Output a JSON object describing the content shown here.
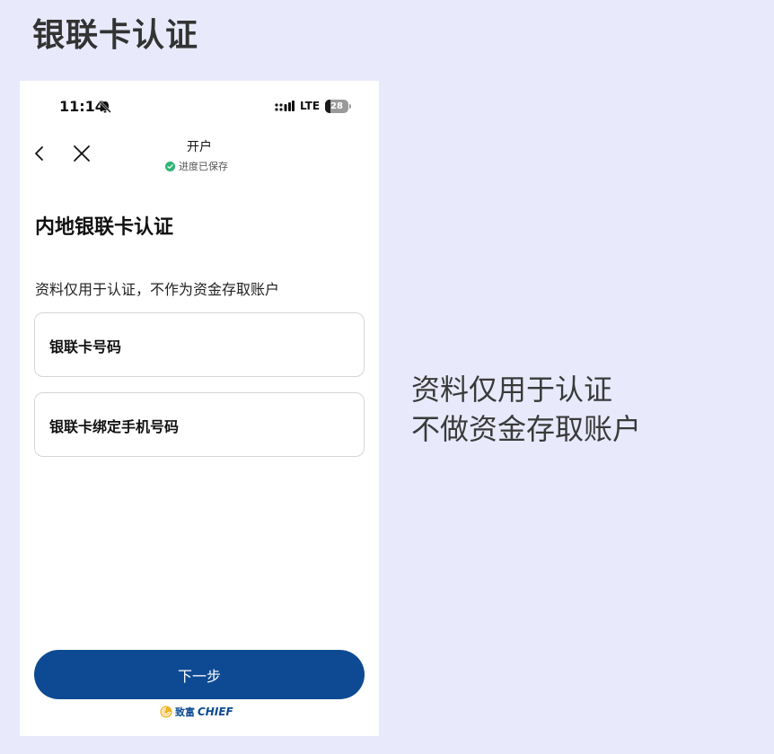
{
  "page": {
    "heading": "银联卡认证"
  },
  "status_bar": {
    "time": "11:14",
    "network": "LTE",
    "battery": "28"
  },
  "nav": {
    "title": "开户",
    "save_status": "进度已保存"
  },
  "form": {
    "title": "内地银联卡认证",
    "subtitle": "资料仅用于认证，不作为资金存取账户",
    "fields": [
      {
        "label": "银联卡号码"
      },
      {
        "label": "银联卡绑定手机号码"
      }
    ]
  },
  "actions": {
    "next_label": "下一步"
  },
  "brand": {
    "cn": "致富",
    "en": "CHIEF",
    "color": "#0d4a93"
  },
  "caption": {
    "line1": "资料仅用于认证",
    "line2": "不做资金存取账户"
  },
  "colors": {
    "primary": "#0d4a93",
    "background": "#e8eafb",
    "success": "#2bb673"
  },
  "icons": [
    "bell-muted-icon",
    "signal-icon",
    "back-icon",
    "close-icon",
    "check-circle-icon",
    "logo-icon"
  ]
}
